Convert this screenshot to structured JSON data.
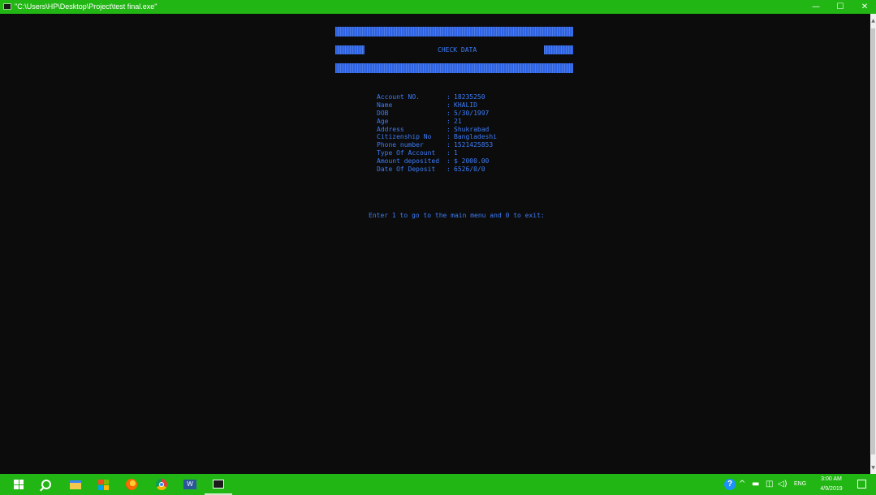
{
  "window": {
    "title": "\"C:\\Users\\HP\\Desktop\\Project\\test final.exe\"",
    "minimize_glyph": "—",
    "maximize_glyph": "☐",
    "close_glyph": "✕",
    "accent_color": "#22b614"
  },
  "console": {
    "heading": "CHECK DATA",
    "text_color": "#3d7cf8",
    "band_color": "#2d63e2",
    "fields": [
      {
        "label": "Account NO.",
        "sep": ":",
        "value": "18235250"
      },
      {
        "label": "Name",
        "sep": ":",
        "value": "KHALID"
      },
      {
        "label": "DOB",
        "sep": ":",
        "value": "5/30/1997"
      },
      {
        "label": "Age",
        "sep": ":",
        "value": "21"
      },
      {
        "label": "Address",
        "sep": ":",
        "value": "Shukrabad"
      },
      {
        "label": "Citizenship No",
        "sep": ":",
        "value": "Bangladeshi"
      },
      {
        "label": "Phone number",
        "sep": ":",
        "value": "1521425853"
      },
      {
        "label": "Type Of Account",
        "sep": ":",
        "value": "1"
      },
      {
        "label": "Amount deposited",
        "sep": ":",
        "value": "$ 2000.00"
      },
      {
        "label": "Date Of Deposit",
        "sep": ":",
        "value": "6526/0/0"
      }
    ],
    "prompt": "Enter 1 to go to the main menu and 0 to exit:"
  },
  "scrollbar": {
    "up_glyph": "▲",
    "down_glyph": "▼"
  },
  "taskbar": {
    "icons": [
      "windows-start-icon",
      "search-icon",
      "file-explorer-icon",
      "store-icon",
      "firefox-icon",
      "chrome-icon",
      "word-icon",
      "console-app-icon"
    ],
    "word_letter": "W",
    "tray": {
      "help_glyph": "?",
      "chevron_glyph": "^",
      "battery_glyph": "▬",
      "network_glyph": "◫",
      "volume_glyph": "◁)",
      "language": "ENG",
      "time": "3:00 AM",
      "date": "4/9/2019"
    }
  }
}
